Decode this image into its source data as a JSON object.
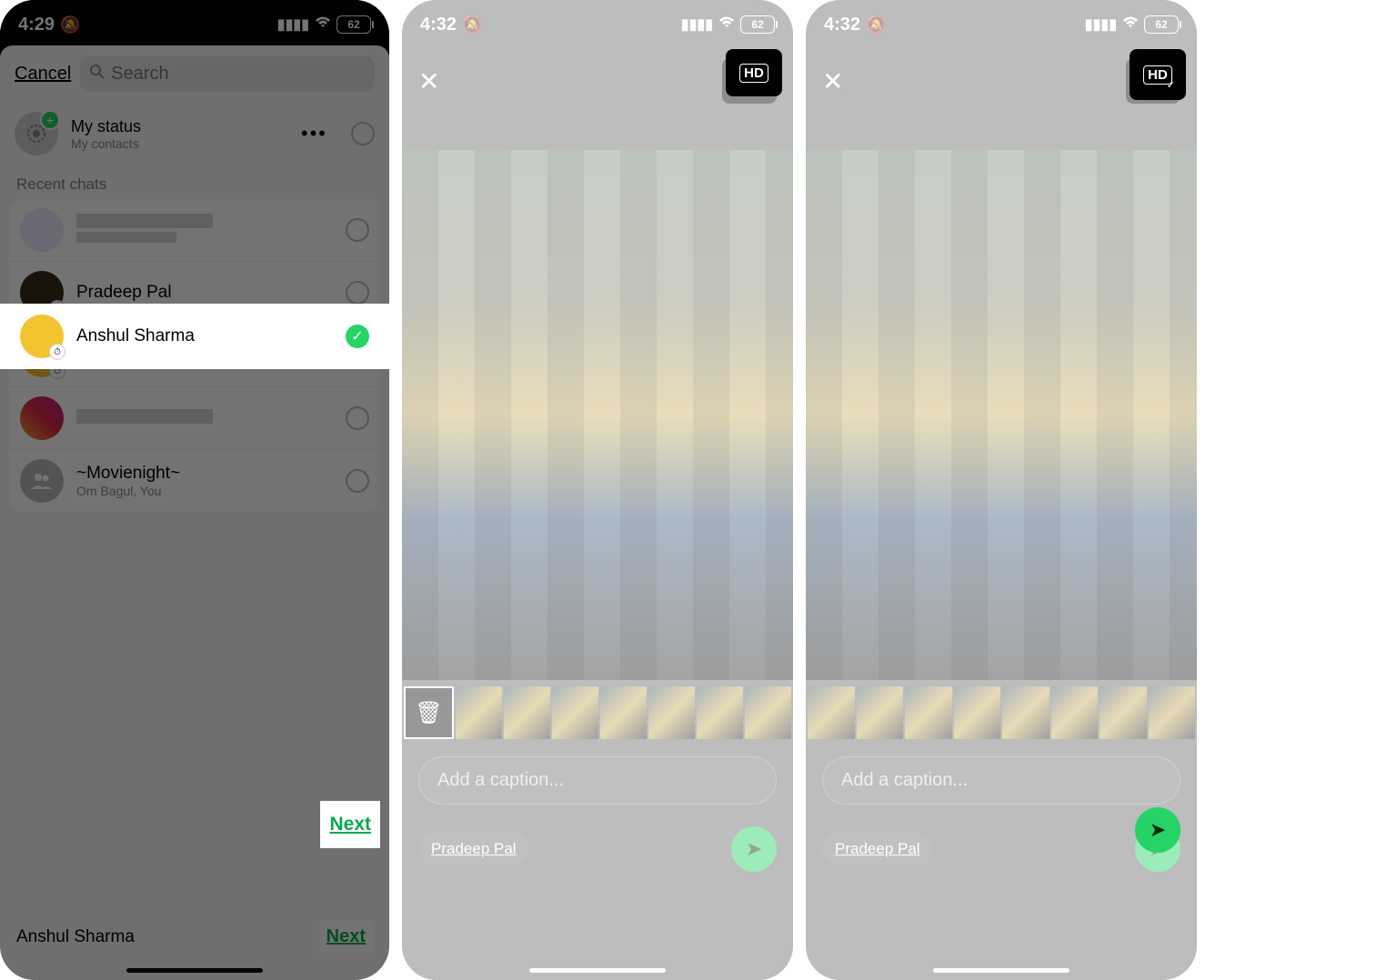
{
  "panel1": {
    "status_time": "4:29",
    "battery": "62",
    "cancel": "Cancel",
    "search_placeholder": "Search",
    "my_status": {
      "title": "My status",
      "sub": "My contacts"
    },
    "recent_label": "Recent chats",
    "chats": [
      {
        "name_hidden": true
      },
      {
        "name": "Pradeep Pal"
      },
      {
        "name": "Anshul Sharma",
        "selected": true
      },
      {
        "name_hidden": true,
        "avatar": "insta"
      },
      {
        "name": "~Movienight~",
        "sub": "Om Bagul, You",
        "avatar": "group"
      }
    ],
    "selected_name": "Anshul Sharma",
    "next": "Next"
  },
  "panel2": {
    "status_time": "4:32",
    "battery": "62",
    "hd_label": "HD",
    "caption_placeholder": "Add a caption...",
    "recipient": "Pradeep Pal"
  },
  "panel3": {
    "status_time": "4:32",
    "battery": "62",
    "hd_label": "HD",
    "caption_placeholder": "Add a caption...",
    "recipient": "Pradeep Pal"
  }
}
